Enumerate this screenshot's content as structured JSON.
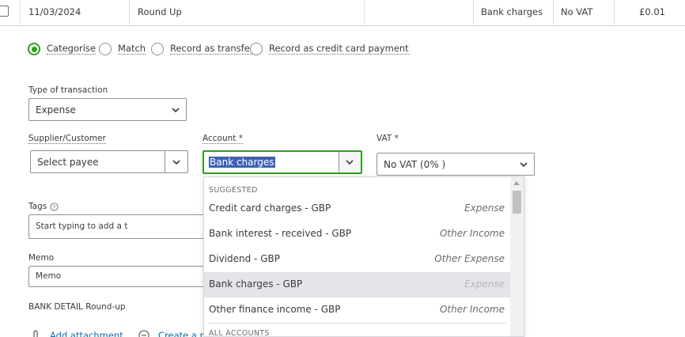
{
  "row": {
    "date": "11/03/2024",
    "description": "Round Up",
    "category": "Bank charges",
    "vat": "No VAT",
    "amount": "£0.01"
  },
  "modes": {
    "categorise": "Categorise",
    "match": "Match",
    "transfer": "Record as transfer",
    "credit_card": "Record as credit card payment",
    "selected": "categorise"
  },
  "form": {
    "type_label": "Type of transaction",
    "type_value": "Expense",
    "payee_label": "Supplier/Customer",
    "payee_placeholder": "Select payee",
    "account_label": "Account *",
    "account_value": "Bank charges",
    "vat_label": "VAT *",
    "vat_value": "No VAT (0% )",
    "tags_label": "Tags",
    "tags_placeholder": "Start typing to add a t",
    "memo_label": "Memo",
    "memo_value": "Memo",
    "bank_detail": "BANK DETAIL Round-up",
    "add_attachment": "Add attachment",
    "create_rule": "Create a rul"
  },
  "dropdown": {
    "suggested_header": "SUGGESTED",
    "all_accounts_header": "ALL ACCOUNTS",
    "items": [
      {
        "name": "Credit card charges  - GBP",
        "type": "Expense"
      },
      {
        "name": "Bank interest - received  - GBP",
        "type": "Other Income"
      },
      {
        "name": "Dividend  - GBP",
        "type": "Other Expense"
      },
      {
        "name": "Bank charges  - GBP",
        "type": "Expense"
      },
      {
        "name": "Other finance income  - GBP",
        "type": "Other Income"
      }
    ],
    "highlighted_index": 3
  },
  "colors": {
    "accent_green": "#2ca01c",
    "selection_blue": "#3d62b5",
    "link_blue": "#0d6faf"
  },
  "icons": [
    "checkbox-icon",
    "chevron-down-icon",
    "info-icon",
    "paperclip-icon",
    "rule-icon",
    "scroll-up-icon"
  ]
}
